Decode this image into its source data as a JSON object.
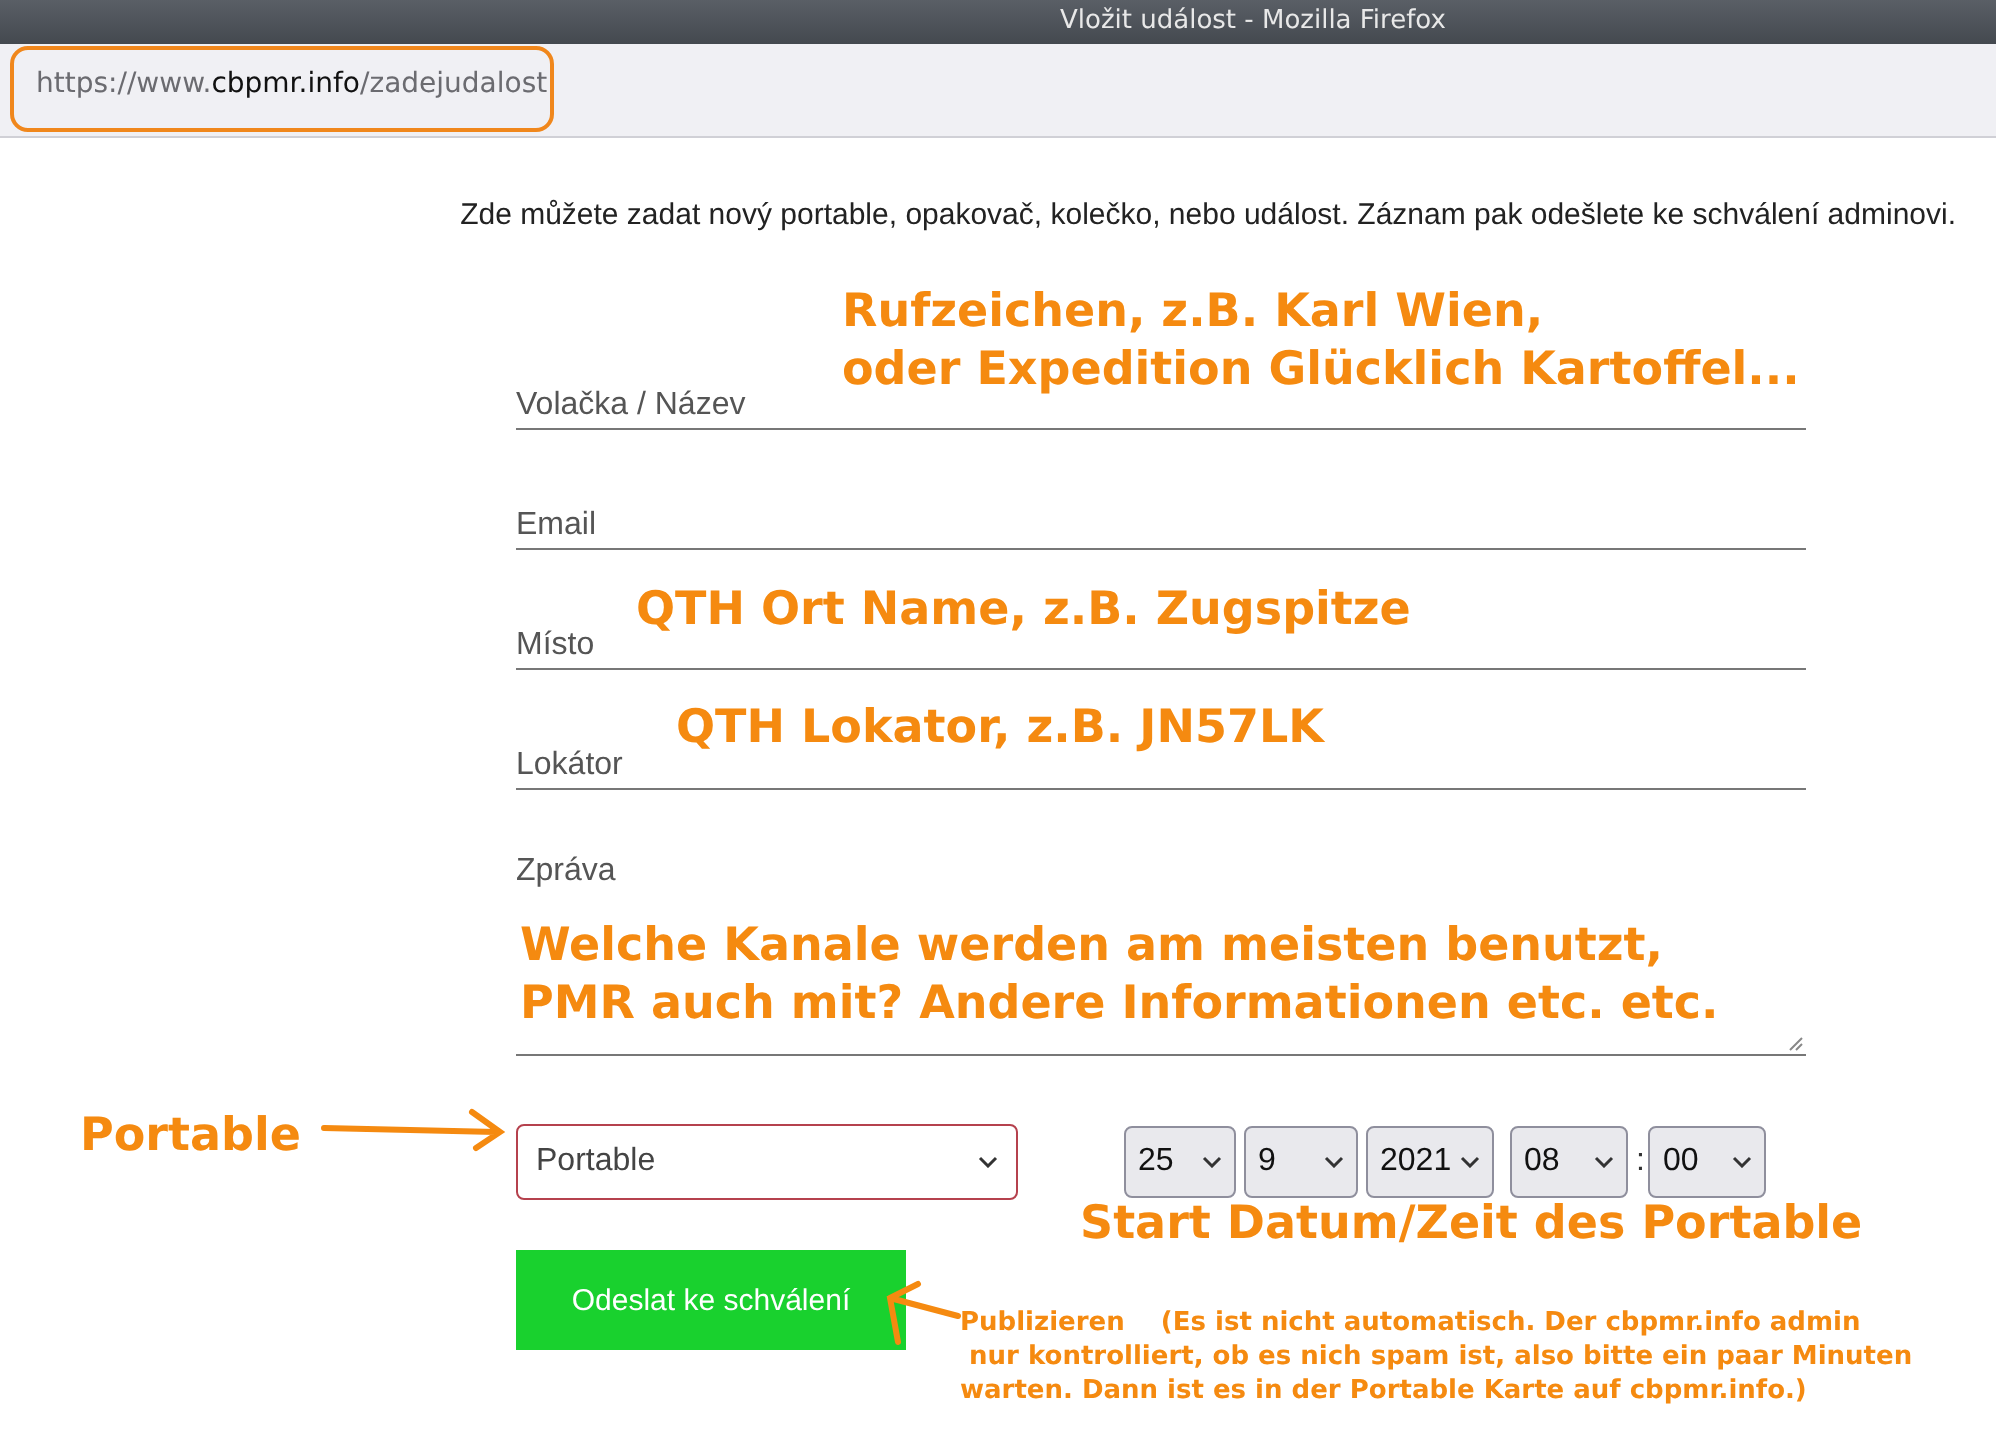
{
  "window": {
    "title": "Vložit událost - Mozilla Firefox"
  },
  "address_bar": {
    "url_prefix": "https://www.",
    "url_domain": "cbpmr.info",
    "url_path": "/zadejudalost"
  },
  "intro": "Zde můžete zadat nový portable, opakovač, kolečko, nebo událost. Záznam pak odešlete ke schválení adminovi.",
  "fields": [
    {
      "kind": "line",
      "label": "Volačka / Název"
    },
    {
      "kind": "line",
      "label": "Email"
    },
    {
      "kind": "line",
      "label": "Místo"
    },
    {
      "kind": "line",
      "label": "Lokátor"
    },
    {
      "kind": "textarea",
      "label": "Zpráva",
      "annotation": "Welche Kanale werden am meisten benutzt,\nPMR auch mit? Andere Informationen etc. etc."
    }
  ],
  "type_select": {
    "value": "Portable"
  },
  "date_selects": [
    {
      "value": "25"
    },
    {
      "value": "9"
    },
    {
      "value": "2021"
    }
  ],
  "time_selects": [
    {
      "value": "08"
    },
    {
      "value": "00"
    }
  ],
  "time_separator": ":",
  "submit_button": "Odeslat ke schválení",
  "annotations": [
    {
      "text": "Rufzeichen, z.B. Karl Wien,\noder Expedition Glücklich Kartoffel..."
    },
    {
      "text": "QTH Ort Name, z.B. Zugspitze"
    },
    {
      "text": "QTH Lokator, z.B. JN57LK"
    },
    {
      "text": "Portable"
    },
    {
      "text": "Start Datum/Zeit des Portable"
    },
    {
      "text": "Publizieren    (Es ist nicht automatisch. Der cbpmr.info admin\n nur kontrolliert, ob es nich spam ist, also bitte ein paar Minuten\nwarten. Dann ist es in der Portable Karte auf cbpmr.info.)",
      "kind": "note"
    }
  ]
}
